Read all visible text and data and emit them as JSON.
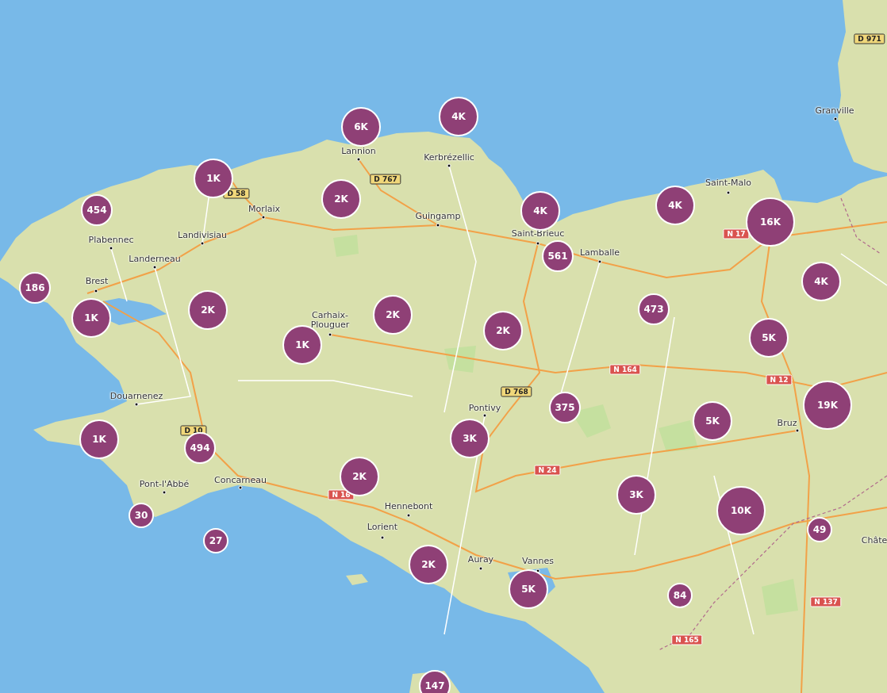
{
  "map": {
    "places": [
      {
        "name": "Granville"
      },
      {
        "name": "Lannion"
      },
      {
        "name": "Kerbrézellic"
      },
      {
        "name": "Saint-Malo"
      },
      {
        "name": "Morlaix"
      },
      {
        "name": "Guingamp"
      },
      {
        "name": "Plabennec"
      },
      {
        "name": "Landivisiau"
      },
      {
        "name": "Saint-Brieuc"
      },
      {
        "name": "Lamballe"
      },
      {
        "name": "Landerneau"
      },
      {
        "name": "Brest"
      },
      {
        "name": "Carhaix-Plouguer"
      },
      {
        "name": "Douarnenez"
      },
      {
        "name": "Pontivy"
      },
      {
        "name": "Bruz"
      },
      {
        "name": "Concarneau"
      },
      {
        "name": "Pont-l'Abbé"
      },
      {
        "name": "Hennebont"
      },
      {
        "name": "Lorient"
      },
      {
        "name": "Châte"
      },
      {
        "name": "Auray"
      },
      {
        "name": "Vannes"
      }
    ],
    "road_shields": [
      {
        "label": "D 971",
        "kind": "departmental"
      },
      {
        "label": "D 767",
        "kind": "departmental"
      },
      {
        "label": "D 58",
        "kind": "departmental"
      },
      {
        "label": "N 17",
        "kind": "national"
      },
      {
        "label": "N 164",
        "kind": "national"
      },
      {
        "label": "N 12",
        "kind": "national"
      },
      {
        "label": "D 768",
        "kind": "departmental"
      },
      {
        "label": "D 10",
        "kind": "departmental"
      },
      {
        "label": "N 24",
        "kind": "national"
      },
      {
        "label": "N 16",
        "kind": "national"
      },
      {
        "label": "N 137",
        "kind": "national"
      },
      {
        "label": "N 165",
        "kind": "national"
      }
    ],
    "clusters": [
      {
        "count": "4K"
      },
      {
        "count": "6K"
      },
      {
        "count": "1K"
      },
      {
        "count": "2K"
      },
      {
        "count": "454"
      },
      {
        "count": "4K"
      },
      {
        "count": "4K"
      },
      {
        "count": "16K"
      },
      {
        "count": "561"
      },
      {
        "count": "4K"
      },
      {
        "count": "186"
      },
      {
        "count": "473"
      },
      {
        "count": "2K"
      },
      {
        "count": "2K"
      },
      {
        "count": "1K"
      },
      {
        "count": "2K"
      },
      {
        "count": "5K"
      },
      {
        "count": "1K"
      },
      {
        "count": "19K"
      },
      {
        "count": "375"
      },
      {
        "count": "5K"
      },
      {
        "count": "1K"
      },
      {
        "count": "3K"
      },
      {
        "count": "494"
      },
      {
        "count": "2K"
      },
      {
        "count": "3K"
      },
      {
        "count": "10K"
      },
      {
        "count": "30"
      },
      {
        "count": "49"
      },
      {
        "count": "27"
      },
      {
        "count": "2K"
      },
      {
        "count": "5K"
      },
      {
        "count": "84"
      },
      {
        "count": "147"
      }
    ]
  }
}
